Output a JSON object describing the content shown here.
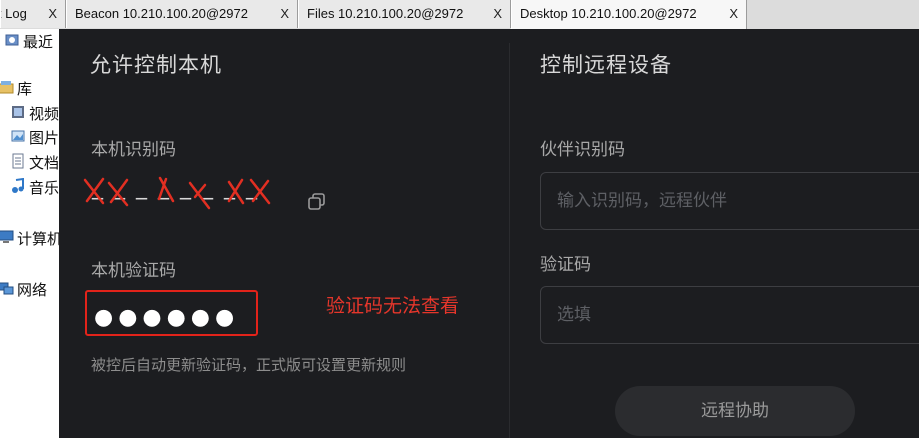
{
  "tabs": [
    {
      "label": "it Log",
      "close": "X"
    },
    {
      "label": "Beacon 10.210.100.20@2972",
      "close": "X"
    },
    {
      "label": "Files 10.210.100.20@2972",
      "close": "X"
    },
    {
      "label": "Desktop 10.210.100.20@2972",
      "close": "X",
      "active": true
    }
  ],
  "explorer": {
    "items": [
      {
        "label": "最近",
        "icon": "recent-icon"
      },
      {
        "label": "库",
        "icon": "library-icon"
      },
      {
        "label": "视频",
        "icon": "video-icon"
      },
      {
        "label": "图片",
        "icon": "picture-icon"
      },
      {
        "label": "文档",
        "icon": "document-icon"
      },
      {
        "label": "音乐",
        "icon": "music-icon"
      },
      {
        "label": "计算机",
        "icon": "computer-icon"
      },
      {
        "label": "网络",
        "icon": "network-icon"
      }
    ]
  },
  "allow_control": {
    "title": "允许控制本机",
    "id_label": "本机识别码",
    "id_value": "_ _ _  _ _  _ _ _",
    "code_label": "本机验证码",
    "code_value": "●●●●●●",
    "hint": "被控后自动更新验证码，正式版可设置更新规则"
  },
  "annotation": "验证码无法查看",
  "remote_control": {
    "title": "控制远程设备",
    "partner_label": "伙伴识别码",
    "partner_placeholder": "输入识别码，远程伙伴",
    "code_label": "验证码",
    "code_placeholder": "选填",
    "assist_button": "远程协助"
  },
  "colors": {
    "panel_bg": "#1c1d20",
    "annotation_red": "#e5362b",
    "highlight_box": "#e2231a"
  }
}
